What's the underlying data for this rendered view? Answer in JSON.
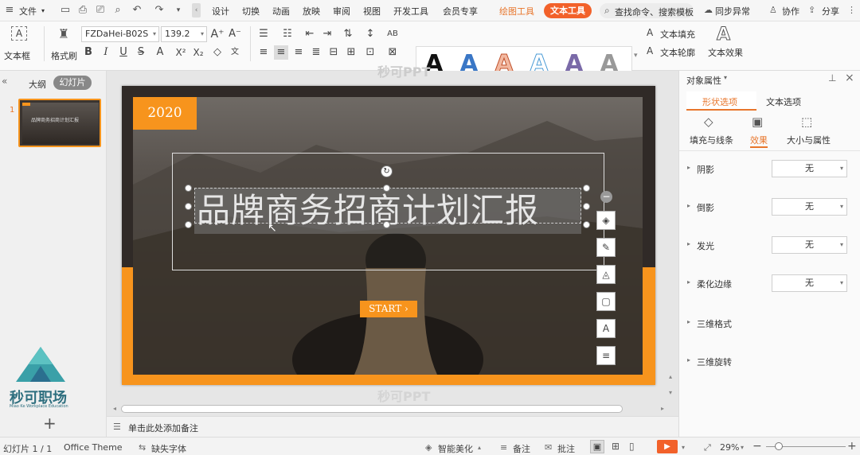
{
  "menu": {
    "file": "文件",
    "items": [
      "设计",
      "切换",
      "动画",
      "放映",
      "审阅",
      "视图",
      "开发工具",
      "会员专享"
    ],
    "drawing_tools": "绘图工具",
    "text_tools": "文本工具",
    "search": "查找命令、搜索模板",
    "sync": "同步异常",
    "collab": "协作",
    "share": "分享"
  },
  "ribbon": {
    "textbox": "文本框",
    "format_painter": "格式刷",
    "font_name": "FZDaHei-B02S",
    "font_size": "139.2",
    "text_fill": "文本填充",
    "text_outline": "文本轮廓",
    "text_effect": "文本效果",
    "style_letter": "A"
  },
  "left_panel": {
    "tab_outline": "大纲",
    "tab_slides": "幻灯片",
    "slide_number": "1",
    "thumb_title": "品牌商务招商计划汇报",
    "logo_text": "秒可职场",
    "logo_sub": "Miao Ke Workplace Education"
  },
  "slide": {
    "year": "2020",
    "title": "品牌商务招商计划汇报",
    "start_button": "START",
    "watermark": "秒可PPT"
  },
  "notes_placeholder": "单击此处添加备注",
  "right_panel": {
    "header": "对象属性",
    "tab_shape": "形状选项",
    "tab_text": "文本选项",
    "sub_fill": "填充与线条",
    "sub_effect": "效果",
    "sub_size": "大小与属性",
    "rows": [
      {
        "label": "阴影",
        "value": "无"
      },
      {
        "label": "倒影",
        "value": "无"
      },
      {
        "label": "发光",
        "value": "无"
      },
      {
        "label": "柔化边缘",
        "value": "无"
      }
    ],
    "section_3d_format": "三维格式",
    "section_3d_rotation": "三维旋转"
  },
  "status": {
    "slide_count": "幻灯片 1 / 1",
    "theme": "Office Theme",
    "missing_font": "缺失字体",
    "beautify": "智能美化",
    "notes": "备注",
    "comments": "批注",
    "zoom": "29%"
  },
  "colors": {
    "accent_orange": "#f7941d",
    "text_tools_tab": "#f2612a",
    "drawing_tools_text": "#e8762c"
  }
}
